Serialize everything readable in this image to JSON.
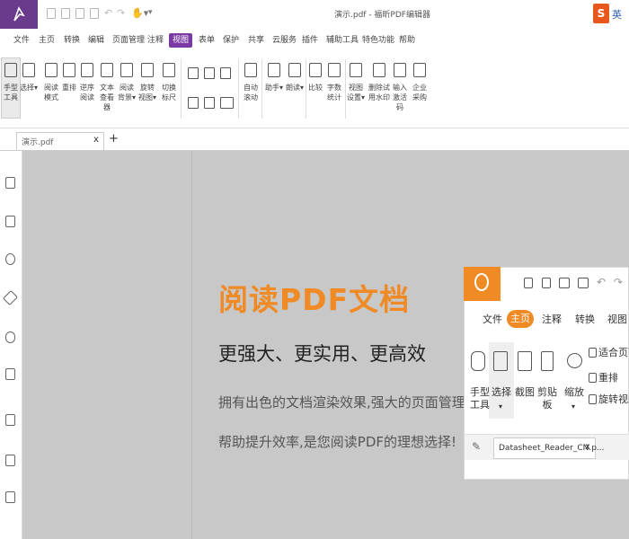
{
  "window": {
    "title": "演示.pdf - 福昕PDF编辑器"
  },
  "ime": {
    "brand": "S",
    "lang": "英"
  },
  "menu": [
    "文件",
    "主页",
    "转换",
    "编辑",
    "页面管理",
    "注释",
    "视图",
    "表单",
    "保护",
    "共享",
    "云服务",
    "插件",
    "辅助工具",
    "特色功能",
    "帮助"
  ],
  "menu_active": "视图",
  "toolbar": {
    "tools": [
      {
        "label": "手型\n工具",
        "icon": "hand-icon"
      },
      {
        "label": "选择▾",
        "icon": "select-text-icon"
      },
      {
        "label": "阅读\n模式",
        "icon": "read-mode-icon"
      },
      {
        "label": "重排",
        "icon": "reflow-icon"
      },
      {
        "label": "逆序\n阅读",
        "icon": "reverse-read-icon"
      },
      {
        "label": "文本\n查看器",
        "icon": "text-viewer-icon"
      },
      {
        "label": "阅读\n背景▾",
        "icon": "read-background-icon"
      },
      {
        "label": "旋转\n视图▾",
        "icon": "rotate-view-icon"
      },
      {
        "label": "切换\n标尺",
        "icon": "ruler-icon"
      },
      {
        "label": "自动\n滚动",
        "icon": "auto-scroll-icon"
      },
      {
        "label": "助手▾",
        "icon": "assistant-icon"
      },
      {
        "label": "朗读▾",
        "icon": "read-aloud-icon"
      },
      {
        "label": "比较",
        "icon": "compare-icon"
      },
      {
        "label": "字数\n统计",
        "icon": "word-count-icon"
      },
      {
        "label": "视图\n设置▾",
        "icon": "view-settings-icon"
      },
      {
        "label": "删除试\n用水印",
        "icon": "remove-watermark-icon"
      },
      {
        "label": "输入\n激活码",
        "icon": "activation-code-icon"
      },
      {
        "label": "企业\n采购",
        "icon": "enterprise-purchase-icon"
      }
    ]
  },
  "tab": {
    "label": "演示.pdf",
    "close": "x",
    "new": "+"
  },
  "promo": {
    "heading": "阅读PDF文档",
    "subheading": "更强大、更实用、更高效",
    "line1": "拥有出色的文档渲染效果,强大的页面管理功能,",
    "line2": "帮助提升效率,是您阅读PDF的理想选择!"
  },
  "embed": {
    "menu": [
      "文件",
      "主页",
      "注释",
      "转换",
      "视图"
    ],
    "active": "主页",
    "tools": {
      "hand": "手型\n工具",
      "select": "选择",
      "screenshot": "截图",
      "clipboard": "剪贴\n板",
      "zoom": "缩放",
      "fit_page": "适合页面",
      "reflow": "重排",
      "rotate": "旋转视图"
    },
    "doc_tab": "Datasheet_Reader_CN.p...",
    "doc_close": "x"
  },
  "colors": {
    "brand_purple": "#7b3aa3",
    "brand_orange": "#f08a24",
    "viewer_gray": "#c8c8c8"
  }
}
